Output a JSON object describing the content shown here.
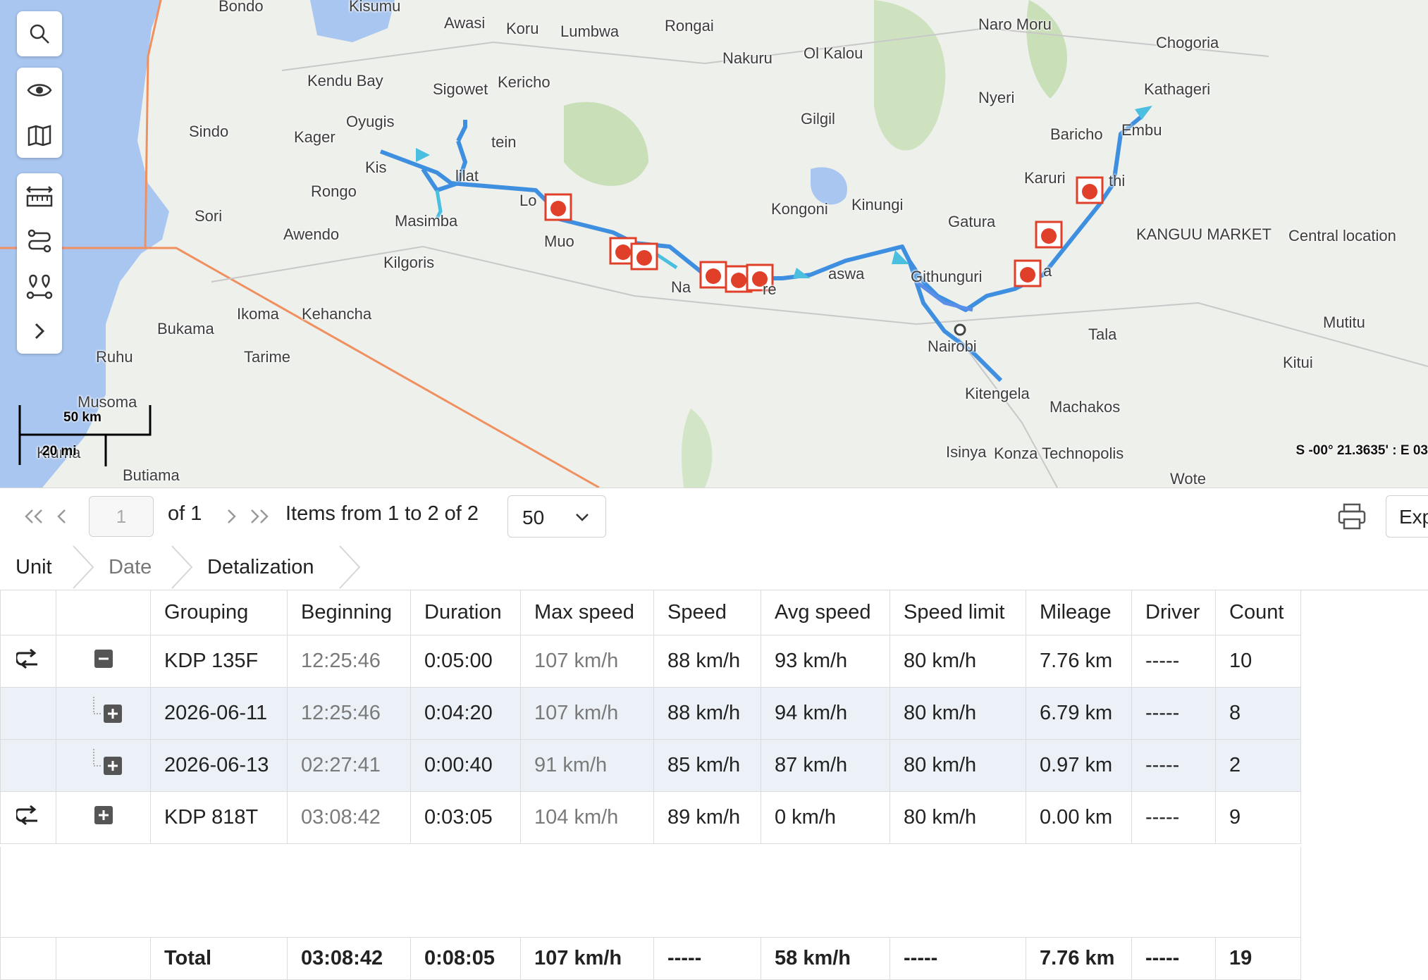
{
  "map": {
    "labels": [
      {
        "id": "bondo",
        "text": "Bondo"
      },
      {
        "id": "kisumu",
        "text": "Kisumu"
      },
      {
        "id": "awasi",
        "text": "Awasi"
      },
      {
        "id": "koru",
        "text": "Koru"
      },
      {
        "id": "lumbwa",
        "text": "Lumbwa"
      },
      {
        "id": "rongai",
        "text": "Rongai"
      },
      {
        "id": "nakuru",
        "text": "Nakuru"
      },
      {
        "id": "olkalou",
        "text": "Ol Kalou"
      },
      {
        "id": "naromoru",
        "text": "Naro Moru"
      },
      {
        "id": "chogoria",
        "text": "Chogoria"
      },
      {
        "id": "kendubay",
        "text": "Kendu Bay"
      },
      {
        "id": "sigowet",
        "text": "Sigowet"
      },
      {
        "id": "kericho",
        "text": "Kericho"
      },
      {
        "id": "nyeri",
        "text": "Nyeri"
      },
      {
        "id": "kathageri",
        "text": "Kathageri"
      },
      {
        "id": "sindo",
        "text": "Sindo"
      },
      {
        "id": "oyugis",
        "text": "Oyugis"
      },
      {
        "id": "kager",
        "text": "Kager"
      },
      {
        "id": "tein",
        "text": "tein"
      },
      {
        "id": "gilgil",
        "text": "Gilgil"
      },
      {
        "id": "baricho",
        "text": "Baricho"
      },
      {
        "id": "embu",
        "text": "Embu"
      },
      {
        "id": "kis",
        "text": "Kis"
      },
      {
        "id": "lilat",
        "text": "lilat"
      },
      {
        "id": "karuri",
        "text": "Karuri"
      },
      {
        "id": "thi",
        "text": "thi"
      },
      {
        "id": "rongo",
        "text": "Rongo"
      },
      {
        "id": "lo",
        "text": "Lo"
      },
      {
        "id": "sori",
        "text": "Sori"
      },
      {
        "id": "kongoni",
        "text": "Kongoni"
      },
      {
        "id": "kinungi",
        "text": "Kinungi"
      },
      {
        "id": "gatura",
        "text": "Gatura"
      },
      {
        "id": "masimba",
        "text": "Masimba"
      },
      {
        "id": "awendo",
        "text": "Awendo"
      },
      {
        "id": "kangumarket",
        "text": "KANGUU MARKET"
      },
      {
        "id": "central",
        "text": "Central location"
      },
      {
        "id": "muo",
        "text": "Muo"
      },
      {
        "id": "kilgoris",
        "text": "Kilgoris"
      },
      {
        "id": "aswa",
        "text": "aswa"
      },
      {
        "id": "githunguri",
        "text": "Githunguri"
      },
      {
        "id": "ka",
        "text": "a"
      },
      {
        "id": "na",
        "text": "Na"
      },
      {
        "id": "re",
        "text": "re"
      },
      {
        "id": "ikoma",
        "text": "Ikoma"
      },
      {
        "id": "kehancha",
        "text": "Kehancha"
      },
      {
        "id": "mutitu",
        "text": "Mutitu"
      },
      {
        "id": "bukama",
        "text": "Bukama"
      },
      {
        "id": "tala",
        "text": "Tala"
      },
      {
        "id": "nairobi",
        "text": "Nairobi"
      },
      {
        "id": "ruhu",
        "text": "Ruhu"
      },
      {
        "id": "tarime",
        "text": "Tarime"
      },
      {
        "id": "kitui",
        "text": "Kitui"
      },
      {
        "id": "kitengela",
        "text": "Kitengela"
      },
      {
        "id": "musoma",
        "text": "Musoma"
      },
      {
        "id": "machakos",
        "text": "Machakos"
      },
      {
        "id": "kiuma",
        "text": "Kiuma"
      },
      {
        "id": "isinya",
        "text": "Isinya"
      },
      {
        "id": "konza",
        "text": "Konza Technopolis"
      },
      {
        "id": "butiama",
        "text": "Butiama"
      },
      {
        "id": "wote",
        "text": "Wote"
      }
    ],
    "scale_km": "50 km",
    "scale_mi": "20 mi",
    "coordinates": "S -00° 21.3635' : E 03",
    "tools": [
      "search-icon",
      "eye-icon",
      "map-icon",
      "ruler-icon",
      "route-icon",
      "markers-icon",
      "chevron-right-icon"
    ]
  },
  "pager": {
    "page_value": "1",
    "of_label": "of 1",
    "items_label": "Items from 1 to 2 of 2",
    "per_page": "50",
    "export_label": "Exp"
  },
  "breadcrumbs": [
    "Unit",
    "Date",
    "Detalization"
  ],
  "table": {
    "headers": [
      "Grouping",
      "Beginning",
      "Duration",
      "Max speed",
      "Speed",
      "Avg speed",
      "Speed limit",
      "Mileage",
      "Driver",
      "Count"
    ],
    "rows": [
      {
        "grouping": "KDP 135F",
        "beginning": "12:25:46",
        "duration": "0:05:00",
        "max_speed": "107 km/h",
        "speed": "88 km/h",
        "avg_speed": "93 km/h",
        "speed_limit": "80 km/h",
        "mileage": "7.76 km",
        "driver": "-----",
        "count": "10"
      },
      {
        "grouping": "2026-06-11",
        "beginning": "12:25:46",
        "duration": "0:04:20",
        "max_speed": "107 km/h",
        "speed": "88 km/h",
        "avg_speed": "94 km/h",
        "speed_limit": "80 km/h",
        "mileage": "6.79 km",
        "driver": "-----",
        "count": "8"
      },
      {
        "grouping": "2026-06-13",
        "beginning": "02:27:41",
        "duration": "0:00:40",
        "max_speed": "91 km/h",
        "speed": "85 km/h",
        "avg_speed": "87 km/h",
        "speed_limit": "80 km/h",
        "mileage": "0.97 km",
        "driver": "-----",
        "count": "2"
      },
      {
        "grouping": "KDP 818T",
        "beginning": "03:08:42",
        "duration": "0:03:05",
        "max_speed": "104 km/h",
        "speed": "89 km/h",
        "avg_speed": "0 km/h",
        "speed_limit": "80 km/h",
        "mileage": "0.00 km",
        "driver": "-----",
        "count": "9"
      }
    ],
    "totals": {
      "label": "Total",
      "beginning": "03:08:42",
      "duration": "0:08:05",
      "max_speed": "107 km/h",
      "speed": "-----",
      "avg_speed": "58 km/h",
      "speed_limit": "-----",
      "mileage": "7.76 km",
      "driver": "-----",
      "count": "19"
    }
  },
  "colors": {
    "track": "#3f8fe0",
    "track_light": "#4bbfe0",
    "marker": "#e0402a",
    "water": "#a9c6f0",
    "border": "#f09060"
  }
}
